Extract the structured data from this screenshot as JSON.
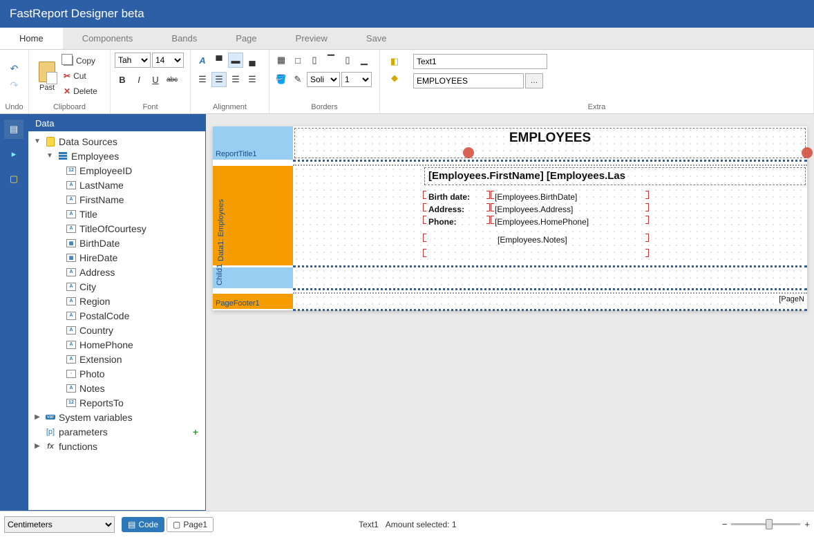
{
  "app": {
    "title": "FastReport Designer beta"
  },
  "tabs": [
    {
      "label": "Home",
      "active": true
    },
    {
      "label": "Components",
      "active": false
    },
    {
      "label": "Bands",
      "active": false
    },
    {
      "label": "Page",
      "active": false
    },
    {
      "label": "Preview",
      "active": false
    },
    {
      "label": "Save",
      "active": false
    }
  ],
  "ribbon": {
    "undo": {
      "label": "Undo"
    },
    "clipboard": {
      "label": "Clipboard",
      "paste": "Past",
      "copy": "Copy",
      "cut": "Cut",
      "delete": "Delete"
    },
    "font": {
      "label": "Font",
      "family": "Tah",
      "size": "14"
    },
    "alignment": {
      "label": "Alignment"
    },
    "borders": {
      "label": "Borders",
      "style": "Soli",
      "width": "1"
    },
    "extra": {
      "label": "Extra",
      "object_name": "Text1",
      "expression": "EMPLOYEES"
    }
  },
  "data_panel": {
    "title": "Data",
    "root": "Data Sources",
    "table": "Employees",
    "fields": [
      {
        "name": "EmployeeID",
        "type": "12"
      },
      {
        "name": "LastName",
        "type": "A"
      },
      {
        "name": "FirstName",
        "type": "A"
      },
      {
        "name": "Title",
        "type": "A"
      },
      {
        "name": "TitleOfCourtesy",
        "type": "A"
      },
      {
        "name": "BirthDate",
        "type": "dt"
      },
      {
        "name": "HireDate",
        "type": "dt"
      },
      {
        "name": "Address",
        "type": "A"
      },
      {
        "name": "City",
        "type": "A"
      },
      {
        "name": "Region",
        "type": "A"
      },
      {
        "name": "PostalCode",
        "type": "A"
      },
      {
        "name": "Country",
        "type": "A"
      },
      {
        "name": "HomePhone",
        "type": "A"
      },
      {
        "name": "Extension",
        "type": "A"
      },
      {
        "name": "Photo",
        "type": "img"
      },
      {
        "name": "Notes",
        "type": "A"
      },
      {
        "name": "ReportsTo",
        "type": "12"
      }
    ],
    "sysvar": "System variables",
    "params": "parameters",
    "functions": "functions"
  },
  "designer": {
    "report_title_band": "ReportTitle1",
    "title_text": "EMPLOYEES",
    "data_band": "Data1: Employees",
    "name_expr": "[Employees.FirstName] [Employees.Las",
    "rows": [
      {
        "label": "Birth date:",
        "value": "[Employees.BirthDate]"
      },
      {
        "label": "Address:",
        "value": "[Employees.Address]"
      },
      {
        "label": "Phone:",
        "value": "[Employees.HomePhone]"
      }
    ],
    "notes_expr": "[Employees.Notes]",
    "child_band": "Child1",
    "page_footer_band": "PageFooter1",
    "page_no": "[PageN"
  },
  "footer": {
    "units": "Centimeters",
    "code": "Code",
    "page": "Page1",
    "status_object": "Text1",
    "status_sel": "Amount selected: 1"
  }
}
